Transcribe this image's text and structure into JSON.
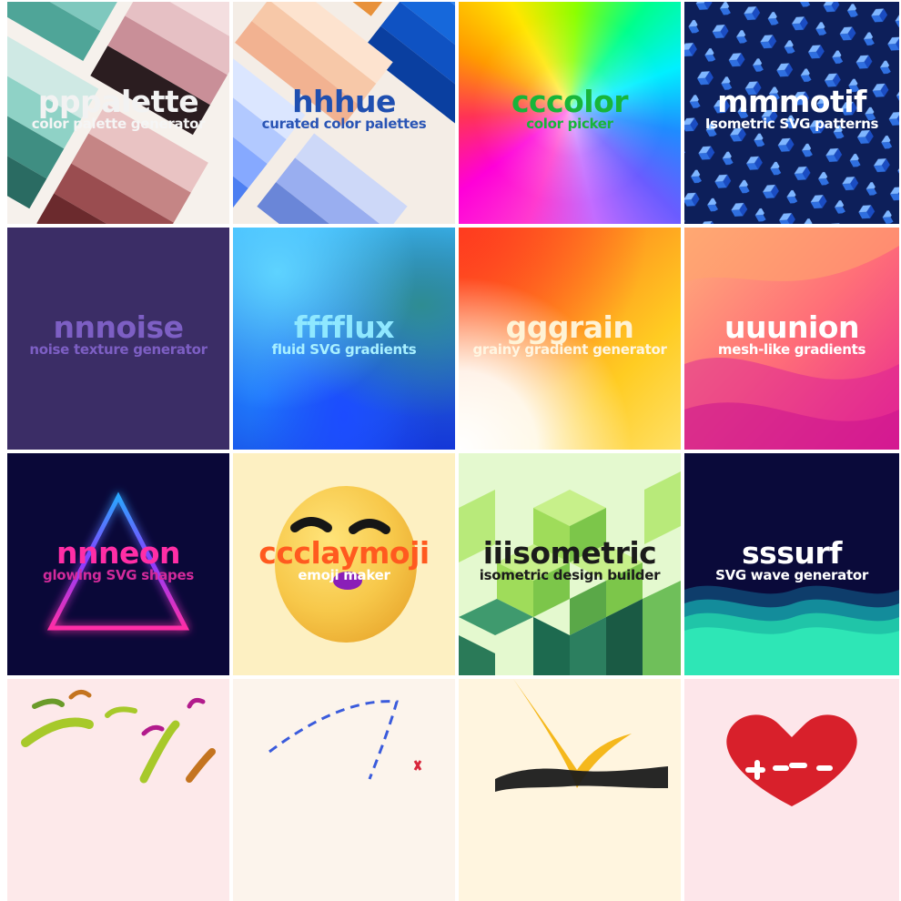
{
  "tiles": [
    {
      "title": "pppalette",
      "subtitle": "color palette generator",
      "title_color": "#f2f2f2",
      "subtitle_color": "#f5f5f5"
    },
    {
      "title": "hhhue",
      "subtitle": "curated color palettes",
      "title_color": "#1f4fb0",
      "subtitle_color": "#2a55b5"
    },
    {
      "title": "cccolor",
      "subtitle": "color picker",
      "title_color": "#17b53a",
      "subtitle_color": "#17b53a"
    },
    {
      "title": "mmmotif",
      "subtitle": "Isometric SVG patterns",
      "title_color": "#ffffff",
      "subtitle_color": "#ffffff"
    },
    {
      "title": "nnnoise",
      "subtitle": "noise texture generator",
      "title_color": "#7d5fc4",
      "subtitle_color": "#7d5fc4"
    },
    {
      "title": "fffflux",
      "subtitle": "fluid SVG gradients",
      "title_color": "#8fe8ff",
      "subtitle_color": "#a8f0ff"
    },
    {
      "title": "gggrain",
      "subtitle": "grainy gradient generator",
      "title_color": "#fff3d6",
      "subtitle_color": "#fff6e2"
    },
    {
      "title": "uuunion",
      "subtitle": "mesh-like gradients",
      "title_color": "#ffffff",
      "subtitle_color": "#ffffff"
    },
    {
      "title": "nnneon",
      "subtitle": "glowing SVG shapes",
      "title_color": "#ff2ea6",
      "subtitle_color": "#d22a9b"
    },
    {
      "title": "ccclaymoji",
      "subtitle": "emoji maker",
      "title_color": "#ff5a1f",
      "subtitle_color": "#ffffff"
    },
    {
      "title": "iiisometric",
      "subtitle": "isometric design builder",
      "title_color": "#1b1b1b",
      "subtitle_color": "#1b1b1b"
    },
    {
      "title": "sssurf",
      "subtitle": "SVG wave generator",
      "title_color": "#ffffff",
      "subtitle_color": "#ffffff"
    },
    {
      "title": "",
      "subtitle": ""
    },
    {
      "title": "",
      "subtitle": ""
    },
    {
      "title": "",
      "subtitle": ""
    },
    {
      "title": "",
      "subtitle": ""
    }
  ]
}
